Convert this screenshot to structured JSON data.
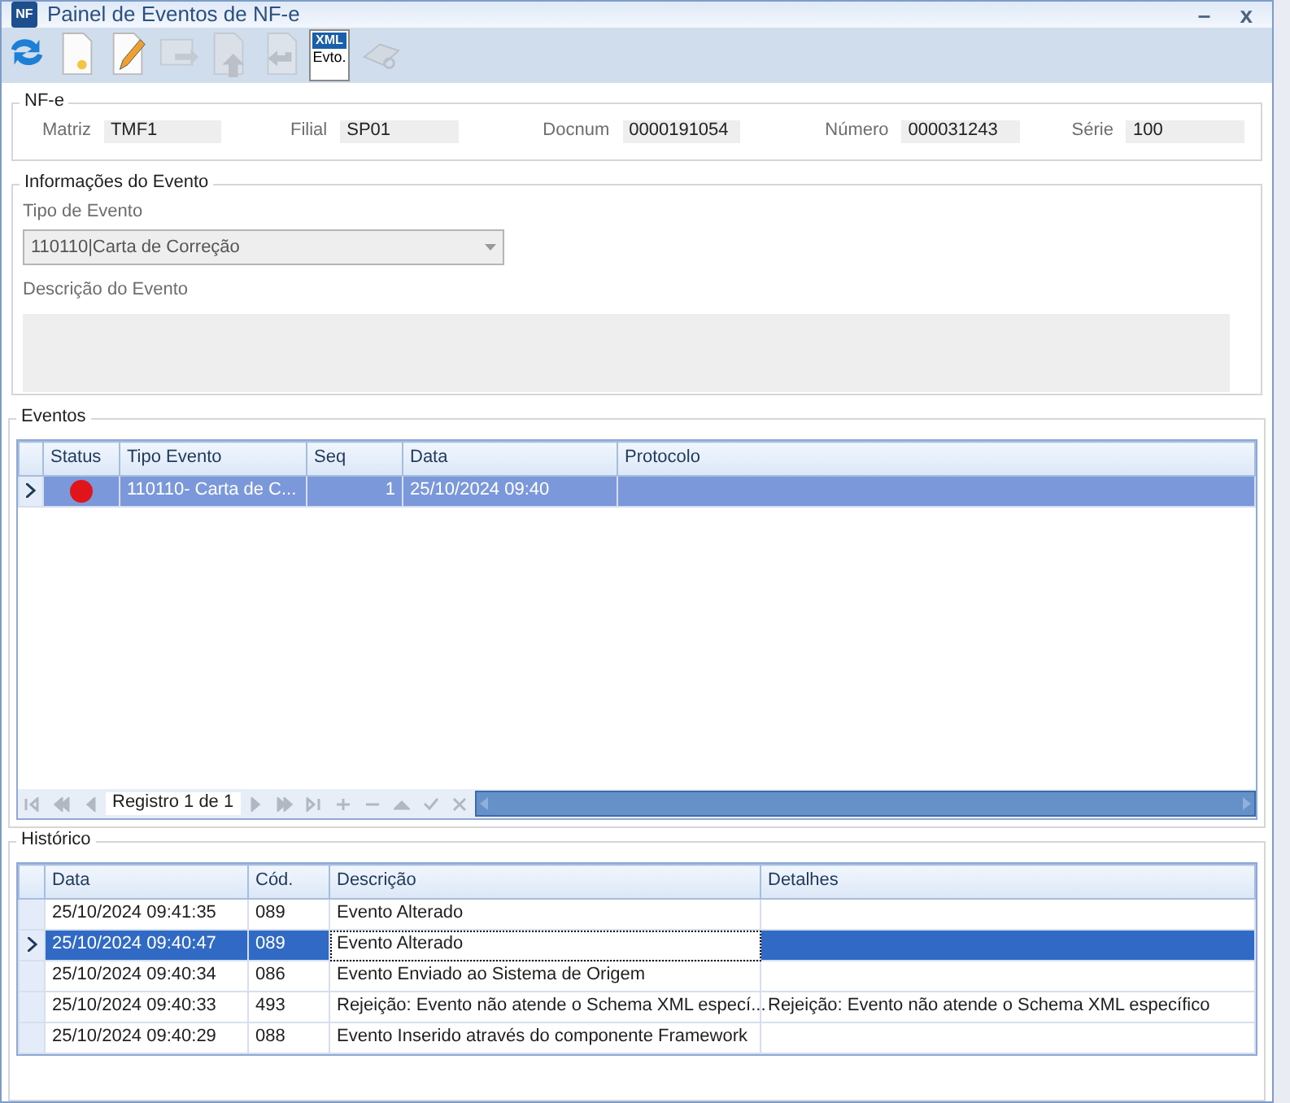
{
  "window": {
    "title": "Painel de Eventos de NF-e",
    "logo": "NF",
    "minimize": "–",
    "close": "x"
  },
  "toolbar": [
    {
      "kind": "refresh",
      "disabled": false
    },
    {
      "kind": "new",
      "disabled": false
    },
    {
      "kind": "edit",
      "disabled": false
    },
    {
      "kind": "send",
      "disabled": true
    },
    {
      "kind": "upload",
      "disabled": true
    },
    {
      "kind": "undo",
      "disabled": true
    },
    {
      "kind": "xml",
      "disabled": false,
      "top": "XML",
      "bottom": "Evto."
    },
    {
      "kind": "print",
      "disabled": true
    }
  ],
  "nfe": {
    "title": "NF-e",
    "fields": [
      {
        "label": "Matriz",
        "value": "TMF1"
      },
      {
        "label": "Filial",
        "value": "SP01"
      },
      {
        "label": "Docnum",
        "value": "0000191054"
      },
      {
        "label": "Número",
        "value": "000031243"
      },
      {
        "label": "Série",
        "value": "100"
      }
    ]
  },
  "info": {
    "title": "Informações do Evento",
    "type_label": "Tipo de Evento",
    "type_value": "110110|Carta de Correção",
    "desc_label": "Descrição do Evento"
  },
  "events": {
    "title": "Eventos",
    "columns": [
      "Status",
      "Tipo Evento",
      "Seq",
      "Data",
      "Protocolo"
    ],
    "rows": [
      {
        "color": "#e0141a",
        "tipo": "110110- Carta de C...",
        "seq": "1",
        "data": "25/10/2024 09:40",
        "protocolo": "",
        "selected": true
      }
    ],
    "navigator": {
      "record": "Registro 1 de 1",
      "buttons": [
        {
          "kind": "first"
        },
        {
          "kind": "prev-page"
        },
        {
          "kind": "prev"
        },
        {
          "kind": "next"
        },
        {
          "kind": "next-page"
        },
        {
          "kind": "last"
        },
        {
          "kind": "add"
        },
        {
          "kind": "remove"
        },
        {
          "kind": "up"
        },
        {
          "kind": "confirm"
        },
        {
          "kind": "cancel"
        }
      ]
    }
  },
  "history": {
    "title": "Histórico",
    "columns": [
      {
        "label": "Data",
        "focused": false
      },
      {
        "label": "Cód.",
        "focused": false
      },
      {
        "label": "Descrição",
        "focused": true
      },
      {
        "label": "Detalhes",
        "focused": false
      }
    ],
    "rows": [
      {
        "cells": [
          "25/10/2024 09:41:35",
          "089",
          "Evento Alterado",
          ""
        ],
        "selected": false
      },
      {
        "cells": [
          "25/10/2024 09:40:47",
          "089",
          "Evento Alterado",
          ""
        ],
        "selected": true
      },
      {
        "cells": [
          "25/10/2024 09:40:34",
          "086",
          "Evento Enviado ao Sistema de Origem",
          ""
        ],
        "selected": false
      },
      {
        "cells": [
          "25/10/2024 09:40:33",
          "493",
          "Rejeição: Evento não atende o Schema XML especí...",
          "Rejeição: Evento não atende o Schema XML específico"
        ],
        "selected": false
      },
      {
        "cells": [
          "25/10/2024 09:40:29",
          "088",
          "Evento Inserido através do componente Framework",
          ""
        ],
        "selected": false
      }
    ]
  }
}
